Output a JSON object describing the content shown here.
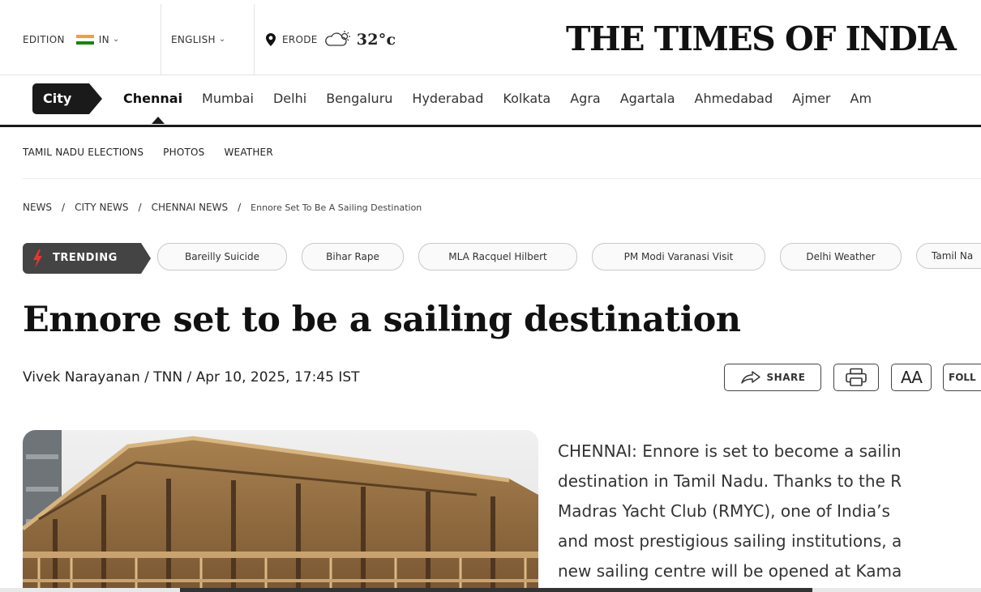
{
  "topbar": {
    "edition_label": "EDITION",
    "edition_value": "IN",
    "language": "ENGLISH",
    "location": "ERODE",
    "temperature": "32°c",
    "masthead": "THE TIMES OF INDIA"
  },
  "citynav": {
    "badge": "City",
    "cities": [
      "Chennai",
      "Mumbai",
      "Delhi",
      "Bengaluru",
      "Hyderabad",
      "Kolkata",
      "Agra",
      "Agartala",
      "Ahmedabad",
      "Ajmer",
      "Am"
    ],
    "active": "Chennai"
  },
  "subnav": [
    "TAMIL NADU ELECTIONS",
    "PHOTOS",
    "WEATHER"
  ],
  "breadcrumb": [
    "NEWS",
    "CITY NEWS",
    "CHENNAI NEWS",
    "Ennore Set To Be A Sailing Destination"
  ],
  "trending": {
    "label": "TRENDING",
    "topics": [
      "Bareilly Suicide",
      "Bihar Rape",
      "MLA Racquel Hilbert",
      "PM Modi Varanasi Visit",
      "Delhi Weather",
      "Tamil Na"
    ]
  },
  "article": {
    "headline": "Ennore set to be a sailing destination",
    "byline": "Vivek Narayanan / TNN / Apr 10, 2025, 17:45 IST",
    "tools": {
      "share": "SHARE",
      "font_size": "AA",
      "follow": "FOLL"
    },
    "body_lines": [
      "CHENNAI: Ennore is set to become a sailin",
      "destination in Tamil Nadu. Thanks to the R",
      "Madras Yacht Club (RMYC), one of India’s",
      "and most prestigious sailing institutions, a",
      "new sailing centre will be opened at Kama"
    ]
  },
  "colors": {
    "flag_saffron": "#ff9933",
    "flag_green": "#138808",
    "badge_bg": "#1a1a1a",
    "trending_bg": "#444444",
    "trending_icon": "#e8342f"
  }
}
